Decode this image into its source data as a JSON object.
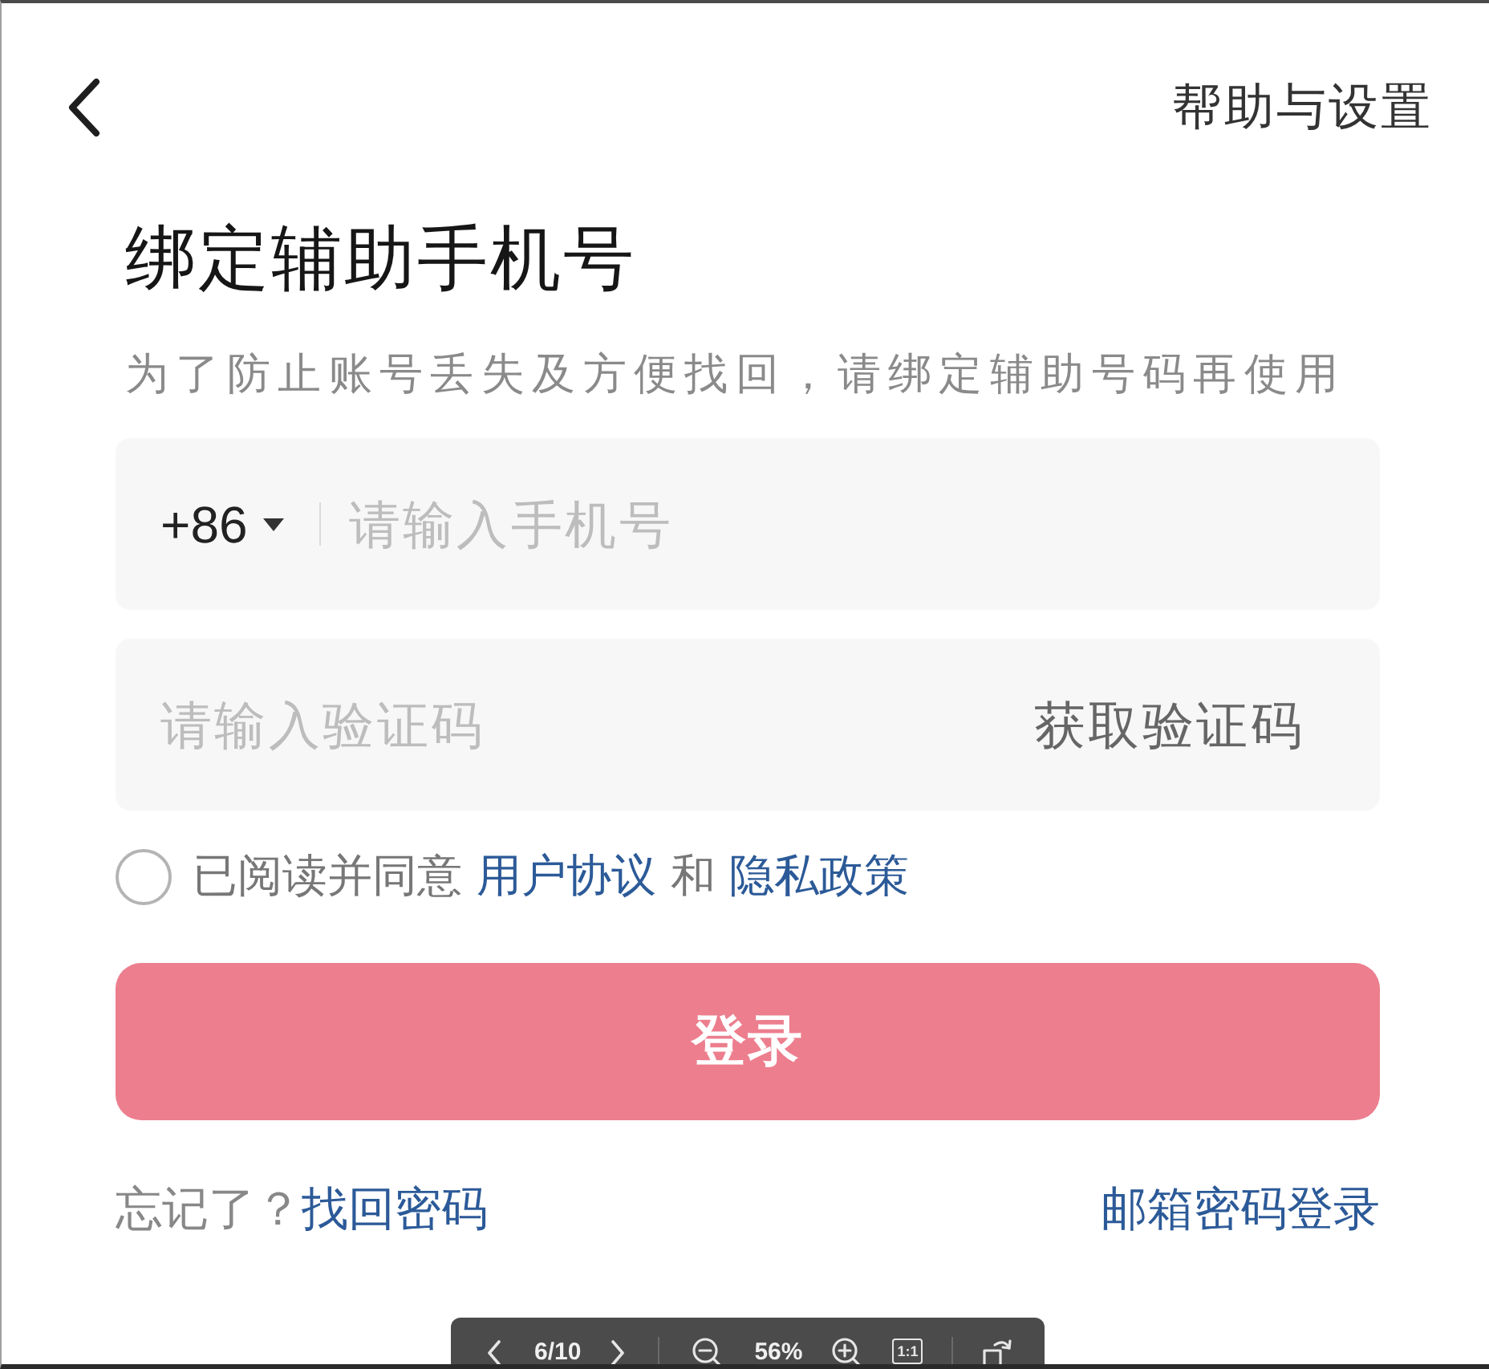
{
  "header": {
    "action": "帮助与设置"
  },
  "title": "绑定辅助手机号",
  "subtitle": "为了防止账号丢失及方便找回，请绑定辅助号码再使用",
  "phone_field": {
    "country_code": "+86",
    "placeholder": "请输入手机号"
  },
  "code_field": {
    "placeholder": "请输入验证码",
    "action": "获取验证码"
  },
  "agreement": {
    "checked": false,
    "parts": [
      {
        "kind": "text",
        "text": "已阅读并同意"
      },
      {
        "kind": "link",
        "text": "用户协议"
      },
      {
        "kind": "text",
        "text": "和"
      },
      {
        "kind": "link",
        "text": "隐私政策"
      }
    ]
  },
  "login_button": {
    "label": "登录",
    "disabled": true
  },
  "footer": {
    "prompt": "忘记了？",
    "recover_link": "找回密码",
    "email_login_link": "邮箱密码登录"
  },
  "viewer_toolbar": {
    "page": "6/10",
    "zoom": "56%",
    "actual_size": "1:1"
  }
}
